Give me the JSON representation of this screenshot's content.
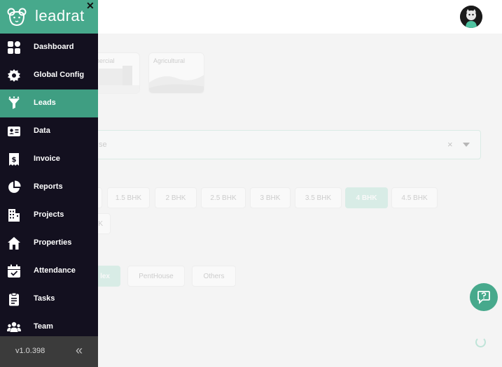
{
  "brand": {
    "name": "leadrat",
    "close_glyph": "✕"
  },
  "sidebar": {
    "items": [
      {
        "label": "Dashboard",
        "icon": "dashboard-icon",
        "active": false
      },
      {
        "label": "Global Config",
        "icon": "gear-icon",
        "active": false
      },
      {
        "label": "Leads",
        "icon": "funnel-icon",
        "active": true
      },
      {
        "label": "Data",
        "icon": "id-card-icon",
        "active": false
      },
      {
        "label": "Invoice",
        "icon": "invoice-icon",
        "active": false
      },
      {
        "label": "Reports",
        "icon": "pie-chart-icon",
        "active": false
      },
      {
        "label": "Projects",
        "icon": "building-icon",
        "active": false
      },
      {
        "label": "Properties",
        "icon": "house-icon",
        "active": false
      },
      {
        "label": "Attendance",
        "icon": "calendar-check-icon",
        "active": false
      },
      {
        "label": "Tasks",
        "icon": "clipboard-icon",
        "active": false
      },
      {
        "label": "Team",
        "icon": "team-icon",
        "active": false
      }
    ],
    "version": "v1.0.398",
    "collapse_glyph": "«"
  },
  "main": {
    "property_types": [
      {
        "label": "Commercial",
        "visible_label": "mmercial"
      },
      {
        "label": "Agricultural",
        "visible_label": "Agricultural"
      }
    ],
    "select": {
      "placeholder": "se",
      "clear_glyph": "×"
    },
    "bhk_options": [
      "1.5 BHK",
      "2 BHK",
      "2.5 BHK",
      "3 BHK",
      "3.5 BHK",
      "4 BHK",
      "4.5 BHK",
      "K"
    ],
    "bhk_selected": "4 BHK",
    "subtypes": [
      "lex",
      "PentHouse",
      "Others"
    ],
    "subtype_selected": "lex"
  },
  "colors": {
    "accent": "#47a98c",
    "sidebar_bg": "#13101f",
    "active_bg": "#3f9e82",
    "footer_bg": "#3b3b3b"
  }
}
